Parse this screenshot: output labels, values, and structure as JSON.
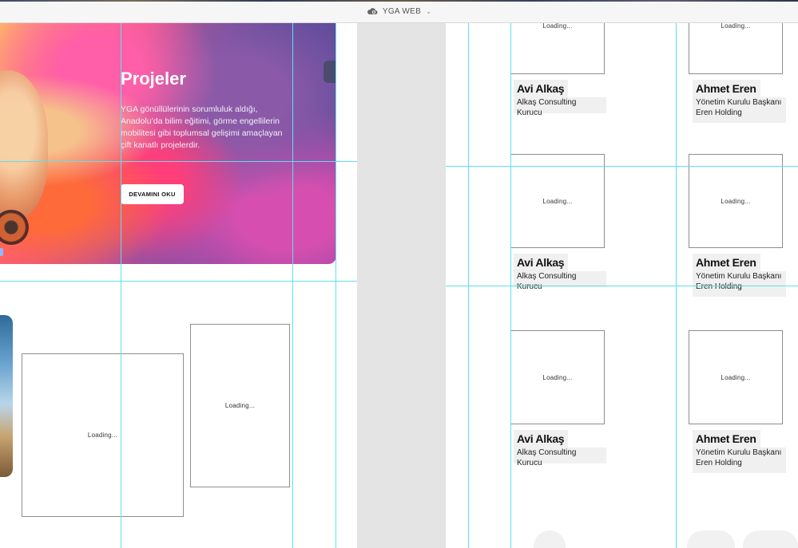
{
  "window": {
    "title": "YGA WEB",
    "cloud_icon": "cloud-sync-icon",
    "dropdown_icon": "chevron-down-icon"
  },
  "hero": {
    "title": "Projeler",
    "description": "YGA gönüllülerinin sorumluluk aldığı, Anadolu’da bilim eğitimi, görme engellilerin mobilitesi gibi toplumsal gelişimi amaçlayan çift kanatlı projelerdir.",
    "button_label": "DEVAMINI OKU"
  },
  "placeholders": {
    "loading_text": "Loading..."
  },
  "members": [
    {
      "name": "Avi Alkaş",
      "role": "Alkaş Consulting Kurucu"
    },
    {
      "name": "Ahmet Eren",
      "role": "Yönetim Kurulu Başkanı Eren Holding"
    },
    {
      "name": "Avi Alkaş",
      "role": "Alkaş Consulting Kurucu"
    },
    {
      "name": "Ahmet Eren",
      "role": "Yönetim Kurulu Başkanı Eren Holding"
    },
    {
      "name": "Avi Alkaş",
      "role": "Alkaş Consulting Kurucu"
    },
    {
      "name": "Ahmet Eren",
      "role": "Yönetim Kurulu Başkanı Eren Holding"
    }
  ],
  "colors": {
    "guide": "#5fe0ef",
    "gutter": "#e4e4e4",
    "label_bg": "#f0f0f0"
  }
}
